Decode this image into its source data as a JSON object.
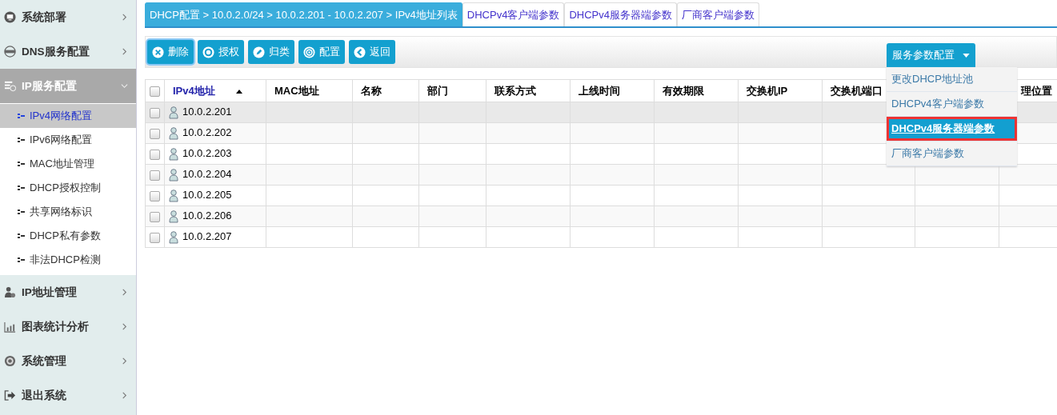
{
  "sidebar": {
    "groups": [
      {
        "label": "系统部署",
        "expanded": false,
        "selected": false
      },
      {
        "label": "DNS服务配置",
        "expanded": false,
        "selected": false
      },
      {
        "label": "IP服务配置",
        "expanded": true,
        "selected": true,
        "children": [
          {
            "label": "IPv4网络配置",
            "selected": true
          },
          {
            "label": "IPv6网络配置",
            "selected": false
          },
          {
            "label": "MAC地址管理",
            "selected": false
          },
          {
            "label": "DHCP授权控制",
            "selected": false
          },
          {
            "label": "共享网络标识",
            "selected": false
          },
          {
            "label": "DHCP私有参数",
            "selected": false
          },
          {
            "label": "非法DHCP检测",
            "selected": false
          }
        ]
      },
      {
        "label": "IP地址管理",
        "expanded": false,
        "selected": false
      },
      {
        "label": "图表统计分析",
        "expanded": false,
        "selected": false
      },
      {
        "label": "系统管理",
        "expanded": false,
        "selected": false
      },
      {
        "label": "退出系统",
        "expanded": false,
        "selected": false
      }
    ]
  },
  "tabs": [
    {
      "label": "DHCP配置 > 10.0.2.0/24 > 10.0.2.201 - 10.0.2.207 > IPv4地址列表",
      "selected": true
    },
    {
      "label": "DHCPv4客户端参数",
      "selected": false
    },
    {
      "label": "DHCPv4服务器端参数",
      "selected": false
    },
    {
      "label": "厂商客户端参数",
      "selected": false
    }
  ],
  "toolbar": {
    "buttons": [
      {
        "label": "删除",
        "focused": true
      },
      {
        "label": "授权",
        "focused": false
      },
      {
        "label": "归类",
        "focused": false
      },
      {
        "label": "配置",
        "focused": false
      },
      {
        "label": "返回",
        "focused": false
      }
    ],
    "dropdown": {
      "label": "服务参数配置",
      "expanded": true,
      "items": [
        {
          "label": "更改DHCP地址池",
          "selected": false
        },
        {
          "label": "DHCPv4客户端参数",
          "selected": false
        },
        {
          "label": "DHCPv4服务器端参数",
          "selected": true
        },
        {
          "label": "厂商客户端参数",
          "selected": false
        }
      ]
    }
  },
  "table": {
    "select_all": {
      "checked": false
    },
    "columns": [
      {
        "label": "IPv4地址",
        "sorted": true
      },
      {
        "label": "MAC地址",
        "sorted": false
      },
      {
        "label": "名称",
        "sorted": false
      },
      {
        "label": "部门",
        "sorted": false
      },
      {
        "label": "联系方式",
        "sorted": false
      },
      {
        "label": "上线时间",
        "sorted": false
      },
      {
        "label": "有效期限",
        "sorted": false
      },
      {
        "label": "交换机IP",
        "sorted": false
      },
      {
        "label": "交换机端口",
        "sorted": false
      },
      {},
      {
        "label": "理位置",
        "sorted": false
      }
    ],
    "rows": [
      {
        "ip": "10.0.2.201",
        "checked": false,
        "selected": true
      },
      {
        "ip": "10.0.2.202",
        "checked": false,
        "selected": false
      },
      {
        "ip": "10.0.2.203",
        "checked": false,
        "selected": false
      },
      {
        "ip": "10.0.2.204",
        "checked": false,
        "selected": false
      },
      {
        "ip": "10.0.2.205",
        "checked": false,
        "selected": false
      },
      {
        "ip": "10.0.2.206",
        "checked": false,
        "selected": false
      },
      {
        "ip": "10.0.2.207",
        "checked": false,
        "selected": false
      }
    ]
  }
}
